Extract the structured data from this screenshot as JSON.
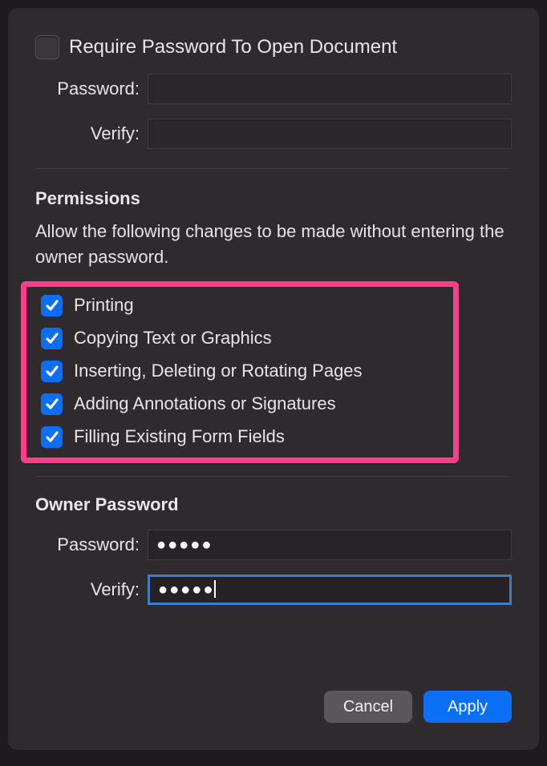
{
  "requirePassword": {
    "label": "Require Password To Open Document",
    "checked": false
  },
  "openPassword": {
    "passwordLabel": "Password:",
    "verifyLabel": "Verify:",
    "passwordValue": "",
    "verifyValue": ""
  },
  "permissions": {
    "title": "Permissions",
    "description": "Allow the following changes to be made without entering the owner password.",
    "items": [
      {
        "label": "Printing",
        "checked": true
      },
      {
        "label": "Copying Text or Graphics",
        "checked": true
      },
      {
        "label": "Inserting, Deleting or Rotating Pages",
        "checked": true
      },
      {
        "label": "Adding Annotations or Signatures",
        "checked": true
      },
      {
        "label": "Filling Existing Form Fields",
        "checked": true
      }
    ]
  },
  "ownerPassword": {
    "title": "Owner Password",
    "passwordLabel": "Password:",
    "verifyLabel": "Verify:",
    "passwordMasked": "●●●●●",
    "verifyMasked": "●●●●●"
  },
  "buttons": {
    "cancel": "Cancel",
    "apply": "Apply"
  }
}
